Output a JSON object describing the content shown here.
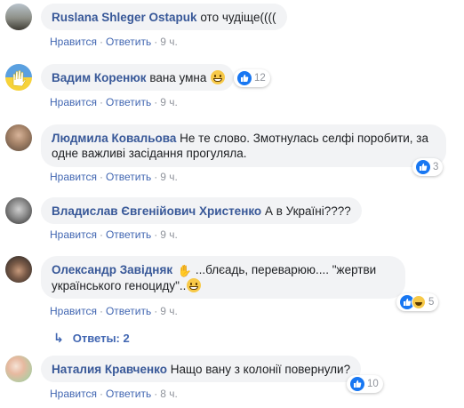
{
  "comments": [
    {
      "author": "Ruslana Shleger Ostapuk",
      "text": "ото чудіще((((",
      "like_label": "Нравится",
      "reply_label": "Ответить",
      "time": "9 ч.",
      "reactions": null
    },
    {
      "author": "Вадим Коренюк",
      "text": "вана умна",
      "like_label": "Нравится",
      "reply_label": "Ответить",
      "time": "9 ч.",
      "reactions": "12"
    },
    {
      "author": "Людмила Ковальова",
      "text": "Не те слово. Змотнулась селфі поробити, за одне важливі засідання прогуляла.",
      "like_label": "Нравится",
      "reply_label": "Ответить",
      "time": "9 ч.",
      "reactions": "3"
    },
    {
      "author": "Владислав Євгенійович Христенко",
      "text": "А в Україні????",
      "like_label": "Нравится",
      "reply_label": "Ответить",
      "time": "9 ч.",
      "reactions": null
    },
    {
      "author": "Олександр Завідняк",
      "text_line1": "...блєадь, переварюю.... \"жертви",
      "text_line2": "українського геноциду\"..",
      "like_label": "Нравится",
      "reply_label": "Ответить",
      "time": "9 ч.",
      "reactions": "5"
    },
    {
      "author": "Наталия Кравченко",
      "text": "Нащо вану з колонії повернули?",
      "like_label": "Нравится",
      "reply_label": "Ответить",
      "time": "8 ч.",
      "reactions": "10"
    }
  ],
  "replies_label": "Ответы: 2",
  "separator": "·",
  "colors": {
    "author": "#385898",
    "link": "#4267b2",
    "meta": "#90949c",
    "bubble": "#f2f3f5"
  }
}
